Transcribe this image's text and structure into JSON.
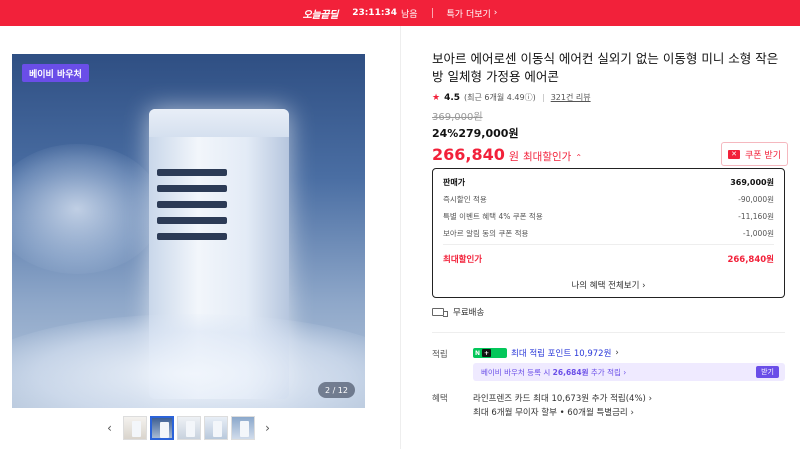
{
  "topbar": {
    "deal_label": "오늘끝딜",
    "timer": "23:11:34",
    "timer_suffix": "남음",
    "more_label": "특가 더보기",
    "color": "#f2213a"
  },
  "gallery": {
    "badge": "베이비 바우처",
    "counter": "2 / 12",
    "thumbnails": [
      "thumb-1",
      "thumb-2",
      "thumb-3",
      "thumb-4",
      "thumb-5"
    ],
    "active_index": 2,
    "prev_icon": "chevron-left-icon",
    "next_icon": "chevron-right-icon"
  },
  "product": {
    "title": "보아르 에어로센 이동식 에어컨 실외기 없는 이동형 미니 소형 작은 방 일체형 가정용 에어콘",
    "rating": "4.5",
    "rating_detail": "(최근 6개월 4.49ⓘ)",
    "reviews": "321건 리뷰",
    "original_price": "369,000원",
    "discount": "24%",
    "sale_price": "279,000원",
    "max_price_amount": "266,840",
    "max_price_unit": "원",
    "max_price_label": "최대할인가",
    "coupon_label": "쿠폰 받기"
  },
  "breakdown": {
    "rows": [
      {
        "label": "판매가",
        "value": "369,000원"
      },
      {
        "label": "즉시할인 적용",
        "value": "-90,000원"
      },
      {
        "label": "특별 이벤트 혜택 4% 쿠폰 적용",
        "value": "-11,160원"
      },
      {
        "label": "보아르 알림 동의 쿠폰 적용",
        "value": "-1,000원"
      }
    ],
    "total_label": "최대할인가",
    "total_value": "266,840원",
    "all_benefits": "나의 혜택 전체보기"
  },
  "shipping": {
    "label": "무료배송"
  },
  "points": {
    "label": "적립",
    "npay_text": "N",
    "npay_plus": "+",
    "max_points": "최대 적립 포인트 10,972원",
    "banner_prefix": "베이비 바우처 등록 시",
    "banner_strong": "26,684원",
    "banner_suffix": "추가 적립",
    "banner_button": "받기"
  },
  "benefits": {
    "label": "혜택",
    "line1": "라인프렌즈 카드 최대 10,673원 추가 적립(4%)",
    "line2": "최대 6개월 무이자 할부 • 60개월 특별금리"
  }
}
